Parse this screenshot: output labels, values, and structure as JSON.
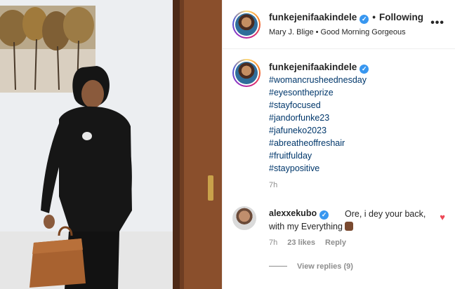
{
  "post": {
    "username": "funkejenifaakindele",
    "follow_status": "Following",
    "music": "Mary J. Blige • Good Morning Gorgeous",
    "more_icon": "more-options-icon"
  },
  "caption": {
    "username": "funkejenifaakindele",
    "hashtags": [
      "#womancrusheednesday",
      "#eyesontheprize",
      "#stayfocused",
      "#jandorfunke23",
      "#jafuneko2023",
      "#abreatheoffreshair",
      "#fruitfulday",
      "#staypositive"
    ],
    "time": "7h"
  },
  "comment": {
    "username": "alexxekubo",
    "text": "Ore, i dey your back, with my Everything",
    "time": "7h",
    "likes": "23 likes",
    "reply_label": "Reply",
    "view_replies": "View replies (9)"
  },
  "colors": {
    "link": "#00376b",
    "verified": "#3897f0",
    "heart": "#ed4956",
    "muted": "#8e8e8e"
  }
}
